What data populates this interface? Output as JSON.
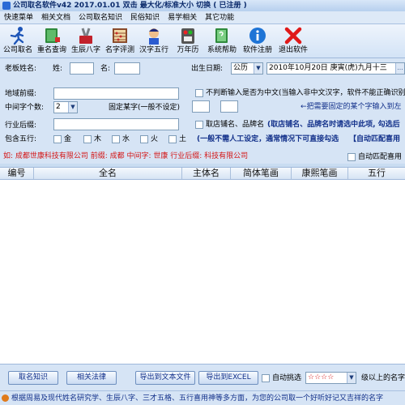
{
  "titlebar": {
    "title": "公司取名软件v42  2017.01.01  双击 最大化/标准大小 切换 ( 已注册 )"
  },
  "menu": [
    "快速菜单",
    "相关文档",
    "公司取名知识",
    "民俗知识",
    "易学相关",
    "其它功能"
  ],
  "toolbar": [
    {
      "label": "公司取名",
      "icon": "runner-icon"
    },
    {
      "label": "重名查询",
      "icon": "book-icon"
    },
    {
      "label": "生辰八字",
      "icon": "tools-icon"
    },
    {
      "label": "名字评测",
      "icon": "abacus-icon"
    },
    {
      "label": "汉字五行",
      "icon": "avatar-icon"
    },
    {
      "label": "万年历",
      "icon": "calendar-icon"
    },
    {
      "label": "系统帮助",
      "icon": "help-book-icon"
    },
    {
      "label": "软件注册",
      "icon": "info-icon"
    },
    {
      "label": "退出软件",
      "icon": "close-icon"
    }
  ],
  "form": {
    "boss_name_label": "老板姓名:",
    "surname_label": "姓:",
    "surname_value": "",
    "given_label": "名:",
    "given_value": "",
    "birth_label": "出生日期:",
    "calendar_type": "公历",
    "birth_date": "2010年10月20日 庚寅(虎)九月十三",
    "region_label": "地域前缀:",
    "region_value": "",
    "chinese_only_label": "不判断输入是否为中文(当输入非中文汉字，软件不能正确识别",
    "middle_count_label": "中间字个数:",
    "middle_count_value": "2",
    "fixed_char_label": "固定某字(一般不设定)",
    "fixed_char_hint": "←把需要固定的某个字输入到左",
    "suffix_label": "行业后缀:",
    "suffix_value": "",
    "shop_name_label": "取店铺名、品牌名",
    "shop_name_note": "(取店铺名、品牌名时请选中此项, 勾选后",
    "wuxing_label": "包含五行:",
    "wuxing": [
      "金",
      "木",
      "水",
      "火",
      "土"
    ],
    "wuxing_note": "(一般不需人工设定，通常情况下可直接勾选",
    "auto_match_top": "【自动匹配喜用",
    "example_text": "如: 成都世康科技有限公司  前缀: 成都  中间字: 世康  行业后缀: 科技有限公司",
    "auto_match_label": "自动匹配喜用"
  },
  "table": {
    "columns": [
      "编号",
      "全名",
      "主体名",
      "简体笔画",
      "康熙笔画",
      "五行"
    ]
  },
  "bottom": {
    "btn_knowledge": "取名知识",
    "btn_law": "相关法律",
    "btn_export_txt": "导出到文本文件",
    "btn_export_excel": "导出到EXCEL",
    "auto_filter_label": "自动挑选",
    "stars": "☆☆☆☆",
    "level_label": "级以上的名字"
  },
  "status": {
    "text": "根据周易及现代姓名研究学、生辰八字、三才五格、五行喜用神等多方面，为您的公司取一个好听好记又吉祥的名字"
  },
  "colors": {
    "accent_red": "#d41414",
    "link_blue": "#12308a",
    "panel": "#d6e4f5"
  }
}
